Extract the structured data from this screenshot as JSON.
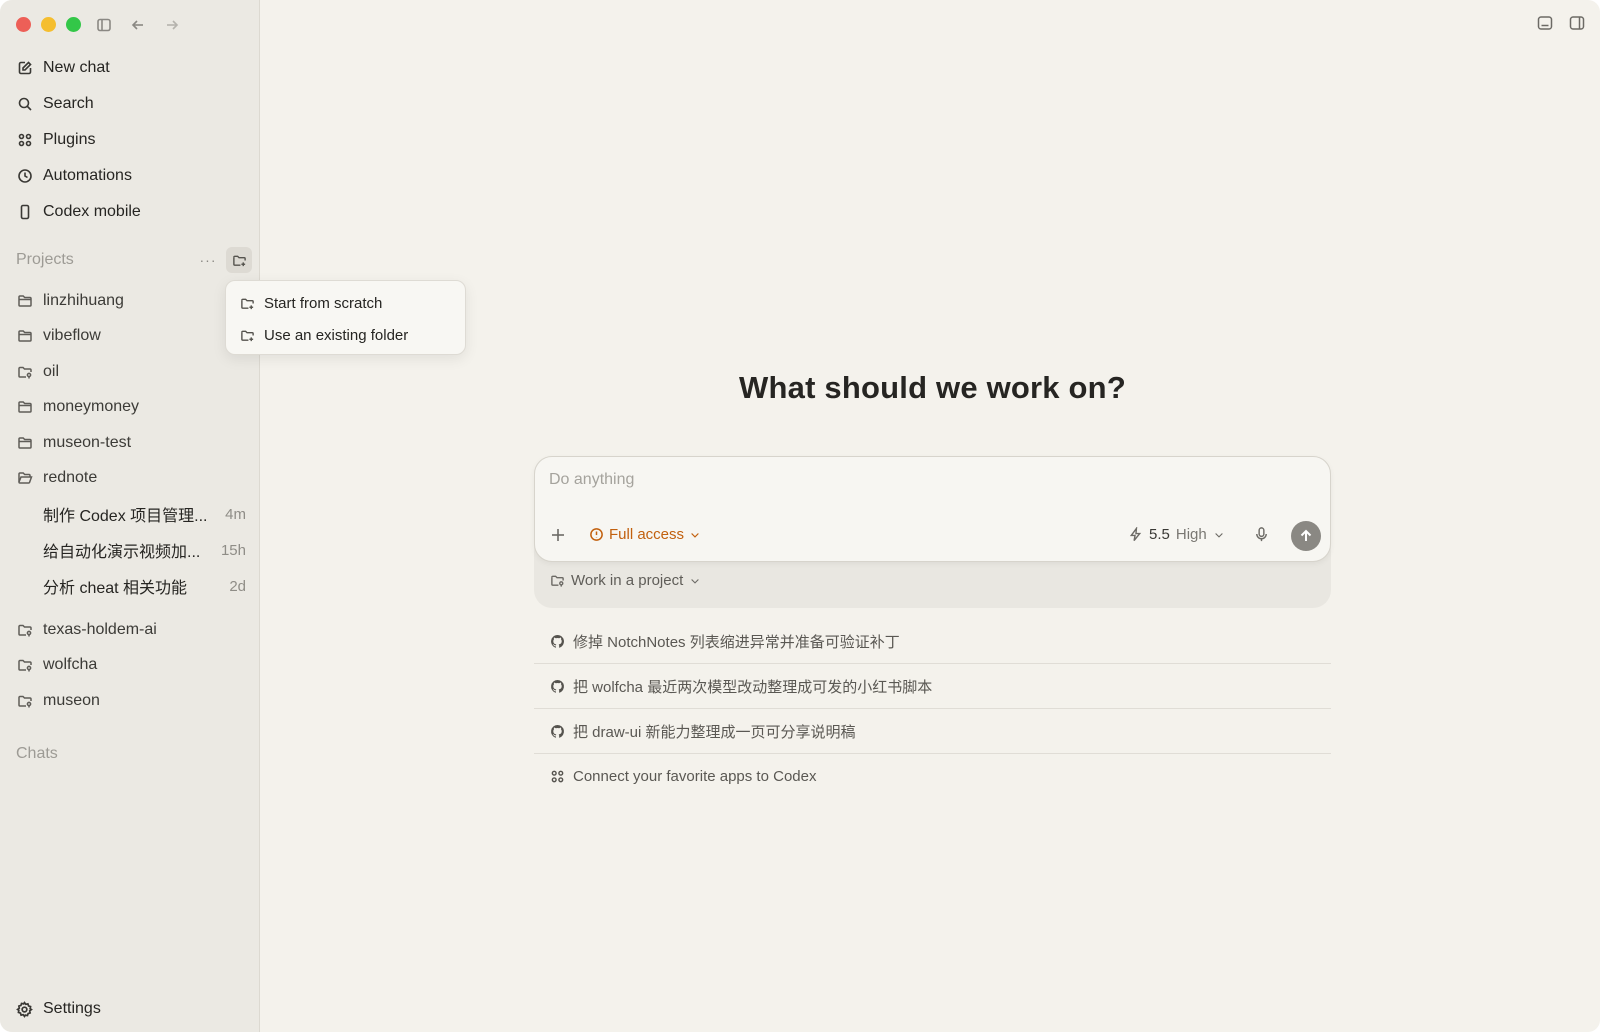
{
  "sidebar": {
    "nav": [
      {
        "label": "New chat",
        "icon": "new-chat-icon"
      },
      {
        "label": "Search",
        "icon": "search-icon"
      },
      {
        "label": "Plugins",
        "icon": "plugins-icon"
      },
      {
        "label": "Automations",
        "icon": "clock-icon"
      },
      {
        "label": "Codex mobile",
        "icon": "phone-icon"
      }
    ],
    "projects_label": "Projects",
    "projects_more": "···",
    "projects": [
      {
        "name": "linzhihuang",
        "icon": "folder-icon"
      },
      {
        "name": "vibeflow",
        "icon": "folder-icon"
      },
      {
        "name": "oil",
        "icon": "folder-git-icon"
      },
      {
        "name": "moneymoney",
        "icon": "folder-icon"
      },
      {
        "name": "museon-test",
        "icon": "folder-icon"
      },
      {
        "name": "rednote",
        "icon": "folder-open-icon"
      }
    ],
    "threads": [
      {
        "title": "制作 Codex 项目管理...",
        "time": "4m"
      },
      {
        "title": "给自动化演示视频加...",
        "time": "15h"
      },
      {
        "title": "分析 cheat 相关功能",
        "time": "2d"
      }
    ],
    "projects_more_list": [
      {
        "name": "texas-holdem-ai",
        "icon": "folder-git-icon"
      },
      {
        "name": "wolfcha",
        "icon": "folder-git-icon"
      },
      {
        "name": "museon",
        "icon": "folder-git-icon"
      }
    ],
    "chats_label": "Chats",
    "settings_label": "Settings"
  },
  "popover": {
    "items": [
      {
        "label": "Start from scratch"
      },
      {
        "label": "Use an existing folder"
      }
    ]
  },
  "main": {
    "headline": "What should we work on?",
    "composer": {
      "placeholder": "Do anything",
      "access_label": "Full access",
      "model_version": "5.5",
      "effort": "High",
      "project_picker": "Work in a project"
    },
    "suggestions": [
      {
        "label": "修掉 NotchNotes 列表缩进异常并准备可验证补丁",
        "icon": "github-icon"
      },
      {
        "label": "把 wolfcha 最近两次模型改动整理成可发的小红书脚本",
        "icon": "github-icon"
      },
      {
        "label": "把 draw-ui 新能力整理成一页可分享说明稿",
        "icon": "github-icon"
      },
      {
        "label": "Connect your favorite apps to Codex",
        "icon": "plugins-icon"
      }
    ]
  },
  "colors": {
    "background": "#f4f2ec",
    "sidebar": "#ebe9e3",
    "accent_warning": "#c2600e"
  }
}
